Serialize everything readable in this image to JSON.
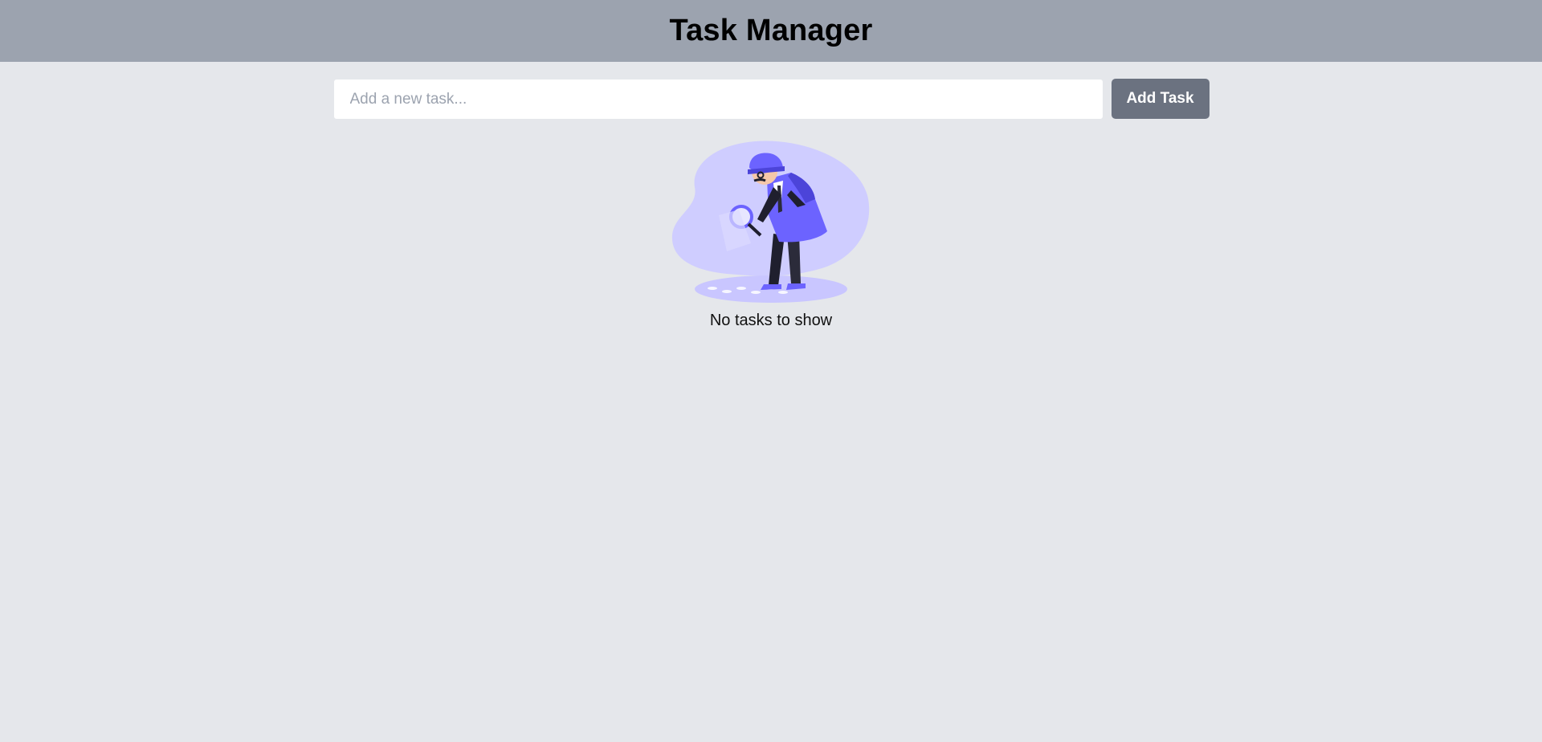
{
  "header": {
    "title": "Task Manager"
  },
  "task_form": {
    "input_value": "",
    "input_placeholder": "Add a new task...",
    "add_button_label": "Add Task"
  },
  "empty_state": {
    "illustration": "detective-searching-illustration",
    "message": "No tasks to show"
  },
  "colors": {
    "header_bg": "#9ca3af",
    "page_bg": "#e5e7eb",
    "button_bg": "#6b7280",
    "illustration_accent": "#6c63ff"
  }
}
